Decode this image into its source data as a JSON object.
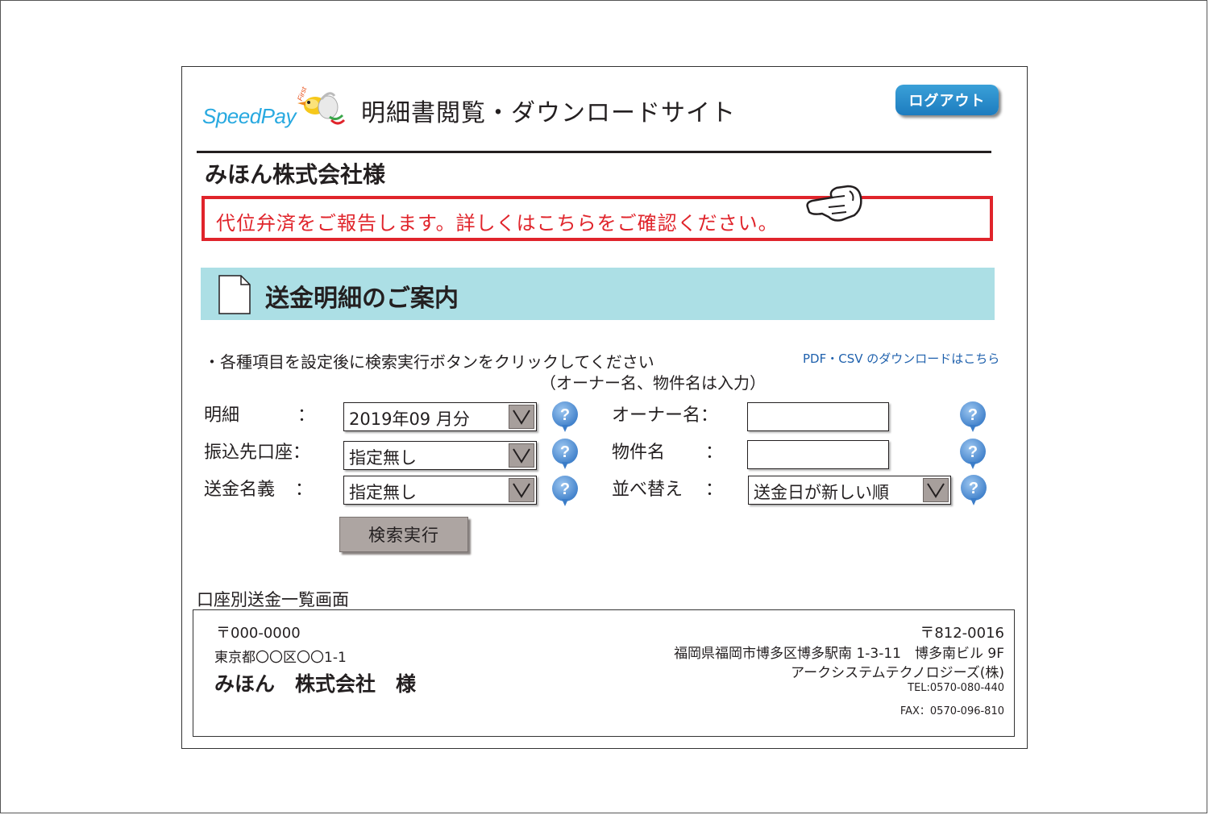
{
  "header": {
    "logo_text": "SpeedPay",
    "logo_sub": "First",
    "site_title": "明細書閲覧・ダウンロードサイト",
    "logout_label": "ログアウト"
  },
  "company_name": "みほん株式会社様",
  "notice": "代位弁済をご報告します。詳しくはこちらをご確認ください。",
  "section": {
    "title": "送金明細のご案内"
  },
  "instruction": "・各種項目を設定後に検索実行ボタンをクリックしてください",
  "instruction_sub": "（オーナー名、物件名は入力）",
  "download_link": "PDF・CSV のダウンロードはこちら",
  "colon": "：",
  "form": {
    "statement_label": "明細",
    "statement_value": "2019年09 月分",
    "account_label": "振込先口座：",
    "account_value": "指定無し",
    "remit_name_label": "送金名義",
    "remit_name_value": "指定無し",
    "owner_label": "オーナー名：",
    "owner_value": "",
    "property_label": "物件名",
    "property_value": "",
    "sort_label": "並べ替え",
    "sort_value": "送金日が新しい順",
    "search_label": "検索実行"
  },
  "preview": {
    "title": "口座別送金一覧画面",
    "recipient_zip": "〒000-0000",
    "recipient_address": "東京都〇〇区〇〇1-1",
    "recipient_name": "みほん　株式会社　様",
    "sender_zip": "〒812-0016",
    "sender_address": "福岡県福岡市博多区博多駅南 1-3-11　博多南ビル 9F",
    "sender_company": "アークシステムテクノロジーズ(株)",
    "sender_tel": "TEL:0570-080-440",
    "sender_fax": "FAX：0570-096-810"
  },
  "colors": {
    "notice_red": "#e0242b",
    "section_bg": "#acdfe5",
    "logout_blue": "#1d7cbf",
    "link_blue": "#1f61ad",
    "help_blue": "#4a8fd4"
  }
}
